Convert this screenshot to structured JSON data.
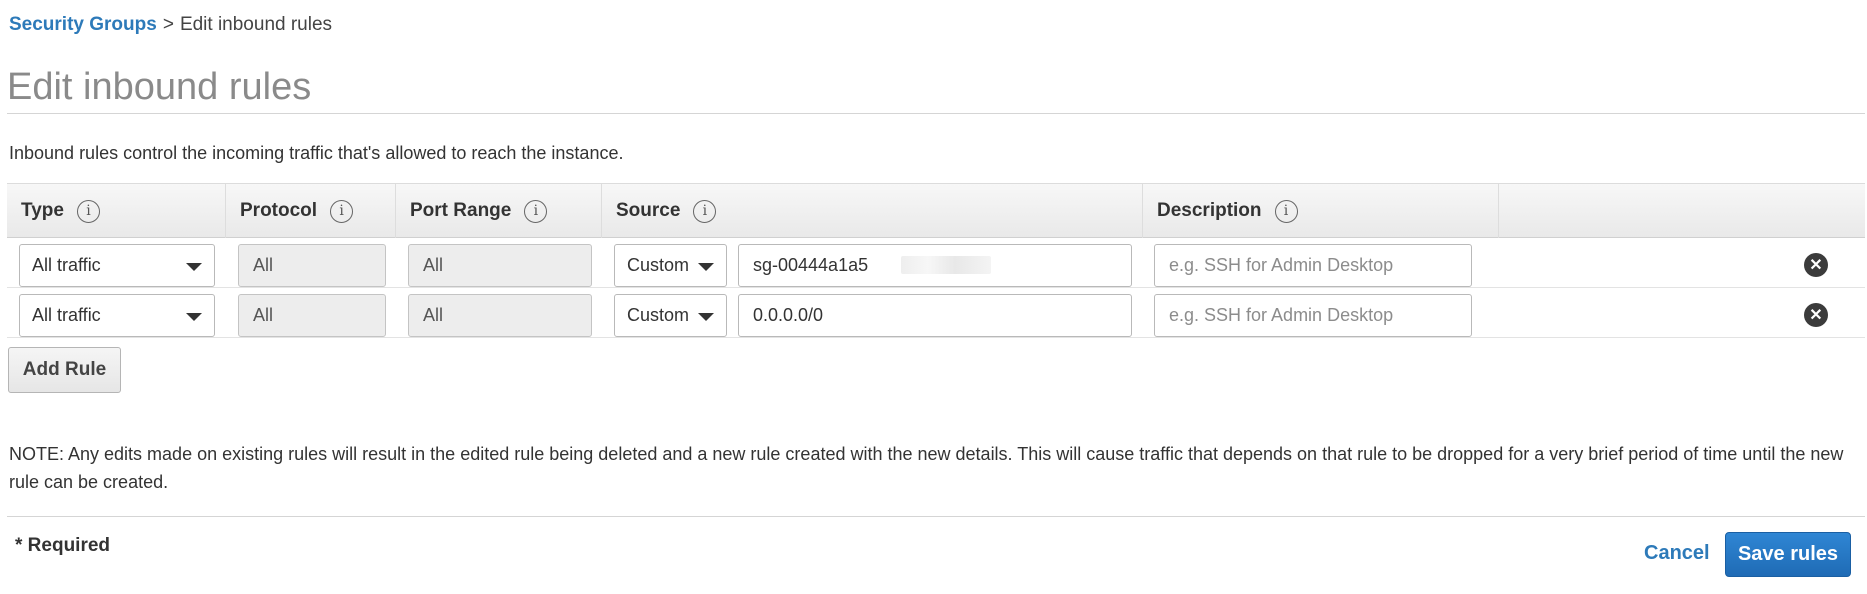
{
  "breadcrumb": {
    "parent": "Security Groups",
    "separator": ">",
    "current": "Edit inbound rules"
  },
  "page": {
    "title": "Edit inbound rules",
    "intro": "Inbound rules control the incoming traffic that's allowed to reach the instance."
  },
  "table": {
    "headers": [
      "Type",
      "Protocol",
      "Port Range",
      "Source",
      "Description"
    ],
    "info_icon_glyph": "i",
    "rows": [
      {
        "type": "All traffic",
        "protocol": "All",
        "port_range": "All",
        "source_type": "Custom",
        "source_value": "sg-00444a1a5",
        "description_placeholder": "e.g. SSH for Admin Desktop"
      },
      {
        "type": "All traffic",
        "protocol": "All",
        "port_range": "All",
        "source_type": "Custom",
        "source_value": "0.0.0.0/0",
        "description_placeholder": "e.g. SSH for Admin Desktop"
      }
    ],
    "remove_glyph": "✕"
  },
  "actions": {
    "add_rule": "Add Rule",
    "cancel": "Cancel",
    "save": "Save rules"
  },
  "note": "NOTE: Any edits made on existing rules will result in the edited rule being deleted and a new rule created with the new details. This will cause traffic that depends on that rule to be dropped for a very brief period of time until the new rule can be created.",
  "required_label": "* Required",
  "colors": {
    "link": "#2d7ab9",
    "primary_button": "#1f6bb5",
    "header_bg": "#eeeeee"
  }
}
